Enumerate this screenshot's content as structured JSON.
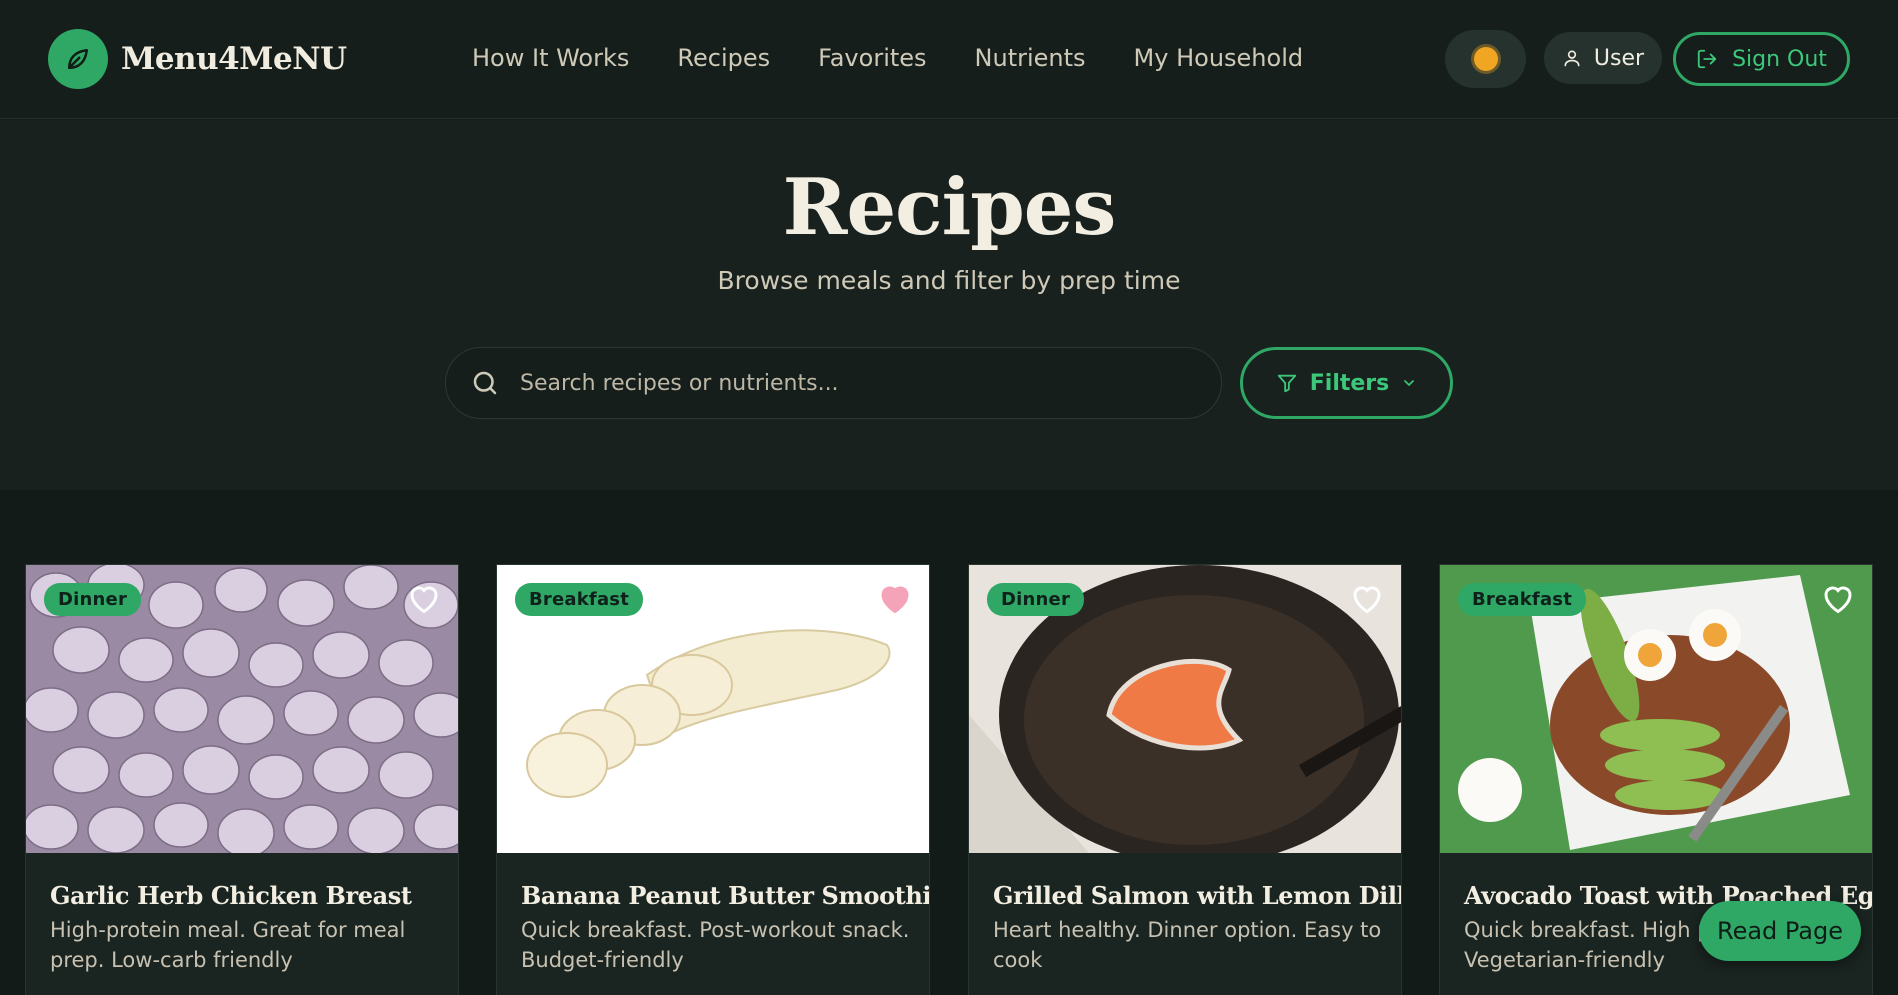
{
  "brand": {
    "name": "Menu4MeNU",
    "icon": "leaf-icon"
  },
  "nav": {
    "links": [
      "How It Works",
      "Recipes",
      "Favorites",
      "Nutrients",
      "My Household"
    ],
    "theme_icon": "sun-icon",
    "user_label": "User",
    "signout_label": "Sign Out"
  },
  "hero": {
    "title": "Recipes",
    "subtitle": "Browse meals and filter by prep time",
    "search_placeholder": "Search recipes or nutrients...",
    "filters_label": "Filters"
  },
  "cards": [
    {
      "category": "Dinner",
      "title": "Garlic Herb Chicken Breast",
      "description": "High-protein meal. Great for meal prep. Low-carb friendly",
      "favorited": false,
      "image": "garlic-bulbs"
    },
    {
      "category": "Breakfast",
      "title": "Banana Peanut Butter Smoothie",
      "description": "Quick breakfast. Post-workout snack. Budget-friendly",
      "favorited": true,
      "image": "sliced-banana"
    },
    {
      "category": "Dinner",
      "title": "Grilled Salmon with Lemon Dill",
      "description": "Heart healthy. Dinner option. Easy to cook",
      "favorited": false,
      "image": "salmon-in-pan"
    },
    {
      "category": "Breakfast",
      "title": "Avocado Toast with Poached Egg",
      "description": "Quick breakfast. High protein. Vegetarian-friendly",
      "favorited": false,
      "image": "avocado-toast-plate"
    }
  ],
  "read_page_label": "Read Page",
  "colors": {
    "accent": "#2fa866",
    "background": "#121b18",
    "heart_active": "#f4a3b8"
  }
}
